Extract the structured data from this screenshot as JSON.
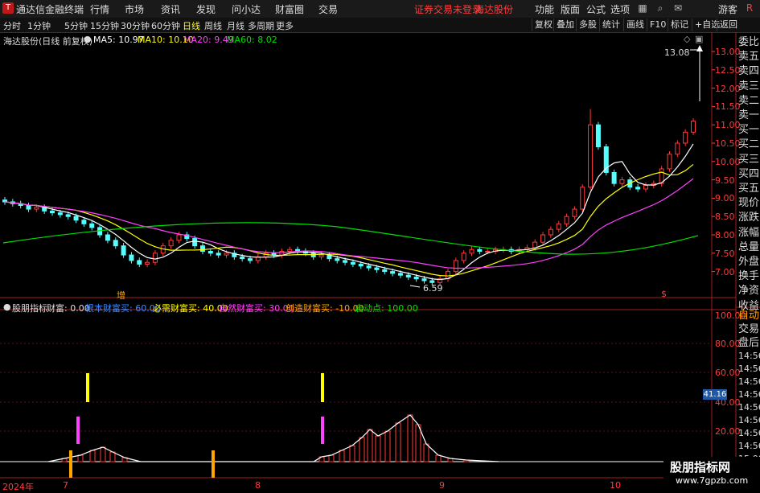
{
  "app": {
    "name": "通达信金融终端",
    "menu": [
      "行情",
      "市场",
      "资讯",
      "发现",
      "问小达",
      "财富圈",
      "交易"
    ],
    "notice": "证券交易未登录",
    "stock_name_title": "海达股份",
    "right_menu": [
      "功能",
      "版面",
      "公式",
      "选项"
    ],
    "guest": "游客"
  },
  "toolbar": {
    "periods": [
      "分时",
      "1分钟",
      "5分钟",
      "15分钟",
      "30分钟",
      "60分钟",
      "日线",
      "周线",
      "月线",
      "多周期",
      "更多"
    ],
    "active_period": "日线",
    "right_buttons": [
      "复权",
      "叠加",
      "多股",
      "统计",
      "画线",
      "F10",
      "标记",
      "+自选",
      "返回"
    ]
  },
  "main_chart": {
    "title": "海达股份(日线 前复权)",
    "ma": [
      {
        "label": "MA5: 10.97",
        "color": "#ffffff"
      },
      {
        "label": "MA10: 10.10",
        "color": "#ffff00"
      },
      {
        "label": "MA20: 9.49",
        "color": "#ff40ff"
      },
      {
        "label": "MA60: 8.02",
        "color": "#00e000"
      }
    ],
    "high_label": "13.08",
    "low_label": "6.59",
    "marker_left": "增",
    "marker_right": "$",
    "y_ticks": [
      "13.00",
      "12.50",
      "12.00",
      "11.50",
      "11.00",
      "10.50",
      "10.00",
      "9.50",
      "9.00",
      "8.50",
      "8.00",
      "7.50",
      "7.00"
    ]
  },
  "indicator": {
    "name": "股朋指标",
    "items": [
      {
        "label": "财富: 0.00",
        "color": "#dddddd"
      },
      {
        "label": "根本财富买: 60.00",
        "color": "#3a8cff"
      },
      {
        "label": "必需财富买: 40.00",
        "color": "#ffff00"
      },
      {
        "label": "自然财富买: 30.00",
        "color": "#ff40ff"
      },
      {
        "label": "创造财富买: -10.00",
        "color": "#ffa500"
      },
      {
        "label": "启动点: 100.00",
        "color": "#00e000"
      }
    ],
    "y_ticks": [
      "100.00",
      "80.00",
      "60.00",
      "40.00",
      "20.00"
    ],
    "current_value": "41.16"
  },
  "x_labels": [
    "2024年",
    "7",
    "8",
    "9",
    "10"
  ],
  "side_panel": {
    "quote_labels": [
      "委比",
      "卖五",
      "卖四",
      "卖三",
      "卖二",
      "卖一",
      "买一",
      "买二",
      "买三",
      "买四",
      "买五",
      "现价",
      "涨跌",
      "涨幅",
      "总量",
      "外盘",
      "换手",
      "净资",
      "收益"
    ],
    "lower": [
      "自动",
      "交易",
      "盘后",
      "14:56",
      "14:56",
      "14:56",
      "14:56",
      "14:56",
      "14:56",
      "14:56",
      "14:56",
      "15:00"
    ]
  },
  "watermark": {
    "line1": "股朋指标网",
    "line2": "www.7gpzb.com"
  }
}
